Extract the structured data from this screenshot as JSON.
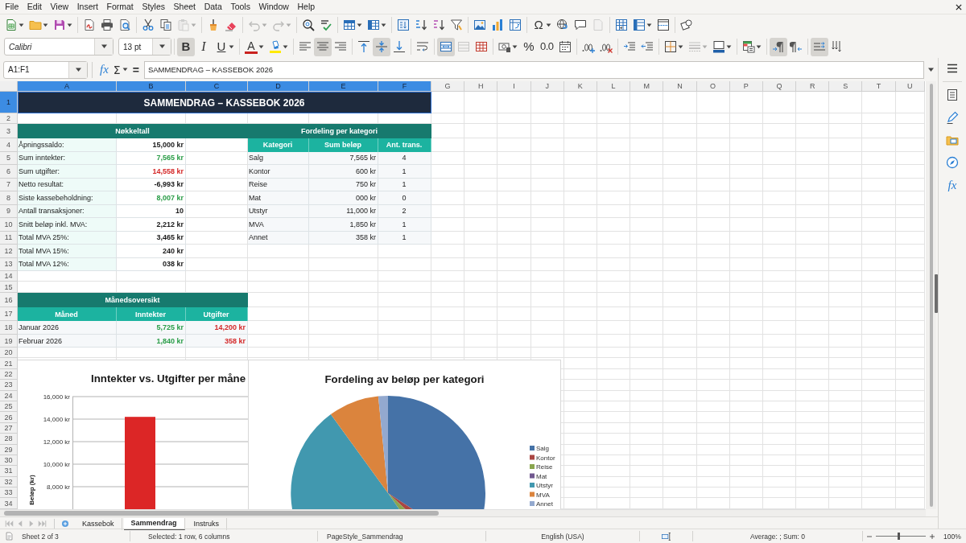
{
  "menu": [
    "File",
    "Edit",
    "View",
    "Insert",
    "Format",
    "Styles",
    "Sheet",
    "Data",
    "Tools",
    "Window",
    "Help"
  ],
  "standard_toolbar": {
    "paste_disabled": true,
    "undo_disabled": true,
    "redo_disabled": true,
    "header_footer_disabled": true,
    "special_character_glyph": "Ω"
  },
  "formatting_toolbar": {
    "font_name": "Calibri",
    "font_size": "13 pt",
    "bold": {
      "glyph": "B",
      "selected": true
    },
    "italic": {
      "glyph": "I",
      "selected": false
    },
    "underline": {
      "glyph": "U",
      "selected": false
    },
    "font_color_glyph": "A",
    "align": [
      {
        "selected": false
      },
      {
        "selected": true
      },
      {
        "selected": false
      }
    ],
    "vertical_align": [
      {
        "selected": false
      },
      {
        "selected": true
      },
      {
        "selected": false
      }
    ],
    "merge_center": {
      "selected": true
    },
    "merge_cells_disabled": true,
    "percent_glyph": "%",
    "number_glyph": "0.0",
    "border_style_disabled": true,
    "left_to_right": {
      "selected": true
    },
    "right_to_left": {
      "selected": false
    },
    "text_horizontal": {
      "selected": true
    },
    "text_vertical": {
      "selected": false
    }
  },
  "formula_bar": {
    "name_box": "A1:F1",
    "function_wizard_glyph": "fx",
    "sum_glyph": "Σ",
    "formula_glyph": "=",
    "content": "SAMMENDRAG – KASSEBOK 2026"
  },
  "sheet": {
    "columns": [
      {
        "label": "A",
        "selected": true
      },
      {
        "label": "B",
        "selected": true
      },
      {
        "label": "C",
        "selected": true
      },
      {
        "label": "D",
        "selected": true
      },
      {
        "label": "E",
        "selected": true
      },
      {
        "label": "F",
        "selected": true
      },
      {
        "label": "G",
        "selected": false
      },
      {
        "label": "H",
        "selected": false
      },
      {
        "label": "I",
        "selected": false
      },
      {
        "label": "J",
        "selected": false
      },
      {
        "label": "K",
        "selected": false
      },
      {
        "label": "L",
        "selected": false
      },
      {
        "label": "M",
        "selected": false
      },
      {
        "label": "N",
        "selected": false
      },
      {
        "label": "O",
        "selected": false
      },
      {
        "label": "P",
        "selected": false
      },
      {
        "label": "Q",
        "selected": false
      },
      {
        "label": "R",
        "selected": false
      },
      {
        "label": "S",
        "selected": false
      },
      {
        "label": "T",
        "selected": false
      },
      {
        "label": "U",
        "selected": false
      }
    ],
    "rows": [
      {
        "label": "1",
        "selected": true
      },
      {
        "label": "2",
        "selected": false
      },
      {
        "label": "3",
        "selected": false
      },
      {
        "label": "4",
        "selected": false
      },
      {
        "label": "5",
        "selected": false
      },
      {
        "label": "6",
        "selected": false
      },
      {
        "label": "7",
        "selected": false
      },
      {
        "label": "8",
        "selected": false
      },
      {
        "label": "9",
        "selected": false
      },
      {
        "label": "10",
        "selected": false
      },
      {
        "label": "11",
        "selected": false
      },
      {
        "label": "12",
        "selected": false
      },
      {
        "label": "13",
        "selected": false
      },
      {
        "label": "14",
        "selected": false
      },
      {
        "label": "15",
        "selected": false
      },
      {
        "label": "16",
        "selected": false
      },
      {
        "label": "17",
        "selected": false
      },
      {
        "label": "18",
        "selected": false
      },
      {
        "label": "19",
        "selected": false
      },
      {
        "label": "20",
        "selected": false
      },
      {
        "label": "21",
        "selected": false
      },
      {
        "label": "22",
        "selected": false
      },
      {
        "label": "23",
        "selected": false
      },
      {
        "label": "24",
        "selected": false
      },
      {
        "label": "25",
        "selected": false
      },
      {
        "label": "26",
        "selected": false
      },
      {
        "label": "27",
        "selected": false
      },
      {
        "label": "28",
        "selected": false
      },
      {
        "label": "29",
        "selected": false
      },
      {
        "label": "30",
        "selected": false
      },
      {
        "label": "31",
        "selected": false
      },
      {
        "label": "32",
        "selected": false
      },
      {
        "label": "33",
        "selected": false
      },
      {
        "label": "34",
        "selected": false
      }
    ],
    "title": "SAMMENDRAG – KASSEBOK 2026",
    "key_figures": {
      "heading": "Nøkkeltall",
      "rows": [
        {
          "label": "Åpningssaldo:",
          "value": "15,000 kr",
          "color": "#1a1a1a"
        },
        {
          "label": "Sum inntekter:",
          "value": "7,565 kr",
          "color": "#2a9d48"
        },
        {
          "label": "Sum utgifter:",
          "value": "14,558 kr",
          "color": "#d42a2a"
        },
        {
          "label": "Netto resultat:",
          "value": "-6,993 kr",
          "color": "#1a1a1a"
        },
        {
          "label": "Siste kassebeholdning:",
          "value": "8,007 kr",
          "color": "#2a9d48"
        },
        {
          "label": "Antall transaksjoner:",
          "value": "10",
          "color": "#1a1a1a"
        },
        {
          "label": "Snitt beløp inkl. MVA:",
          "value": "2,212 kr",
          "color": "#1a1a1a"
        },
        {
          "label": "Total MVA 25%:",
          "value": "3,465 kr",
          "color": "#1a1a1a"
        },
        {
          "label": "Total MVA 15%:",
          "value": "240 kr",
          "color": "#1a1a1a"
        },
        {
          "label": "Total MVA 12%:",
          "value": "038 kr",
          "color": "#1a1a1a"
        }
      ]
    },
    "category_table": {
      "heading": "Fordeling per kategori",
      "columns": [
        "Kategori",
        "Sum beløp",
        "Ant. trans."
      ],
      "rows": [
        [
          "Salg",
          "7,565 kr",
          "4"
        ],
        [
          "Kontor",
          "600 kr",
          "1"
        ],
        [
          "Reise",
          "750 kr",
          "1"
        ],
        [
          "Mat",
          "000 kr",
          "0"
        ],
        [
          "Utstyr",
          "11,000 kr",
          "2"
        ],
        [
          "MVA",
          "1,850 kr",
          "1"
        ],
        [
          "Annet",
          "358 kr",
          "1"
        ]
      ]
    },
    "monthly": {
      "heading": "Månedsoversikt",
      "columns": [
        "Måned",
        "Inntekter",
        "Utgifter"
      ],
      "rows": [
        [
          "Januar 2026",
          "5,725 kr",
          "14,200 kr"
        ],
        [
          "Februar 2026",
          "1,840 kr",
          "358 kr"
        ]
      ]
    },
    "charts": [
      {
        "chart_data": {
          "type": "bar",
          "title": "Inntekter vs. Utgifter per måne",
          "ylabel": "Beløp (kr)",
          "ylim": [
            6000,
            16000
          ],
          "yticks": [
            {
              "value": 8000,
              "label": "8,000 kr"
            },
            {
              "value": 10000,
              "label": "10,000 kr"
            },
            {
              "value": 12000,
              "label": "12,000 kr"
            },
            {
              "value": 14000,
              "label": "14,000 kr"
            },
            {
              "value": 16000,
              "label": "16,000 kr"
            }
          ],
          "grid": true,
          "series": [
            {
              "color": "#dc2626",
              "values": [
                14200
              ]
            }
          ]
        }
      },
      {
        "chart_data": {
          "type": "pie",
          "title": "Fordeling av beløp per kategori",
          "categories": [
            "Salg",
            "Kontor",
            "Reise",
            "Mat",
            "Utstyr",
            "MVA",
            "Annet"
          ],
          "values": [
            34.2,
            2.7,
            3.4,
            0,
            49.7,
            8.4,
            1.6
          ],
          "colors": [
            "#4572a7",
            "#aa4643",
            "#89a54e",
            "#71588f",
            "#4198af",
            "#db843d",
            "#93a9cf"
          ],
          "legend": true
        }
      }
    ]
  },
  "sheet_tabs": [
    {
      "label": "Kassebok",
      "selected": false
    },
    {
      "label": "Sammendrag",
      "selected": true
    },
    {
      "label": "Instruks",
      "selected": false
    }
  ],
  "sidebar": {
    "functions_glyph": "fx"
  },
  "status_bar": {
    "sheet_position": "Sheet 2 of 3",
    "selection_info": "Selected: 1 row, 6 columns",
    "page_style": "PageStyle_Sammendrag",
    "language": "English (USA)",
    "statistics": "Average: ; Sum: 0",
    "zoom_slider": {
      "level": 0.46
    },
    "zoom": "100%"
  }
}
